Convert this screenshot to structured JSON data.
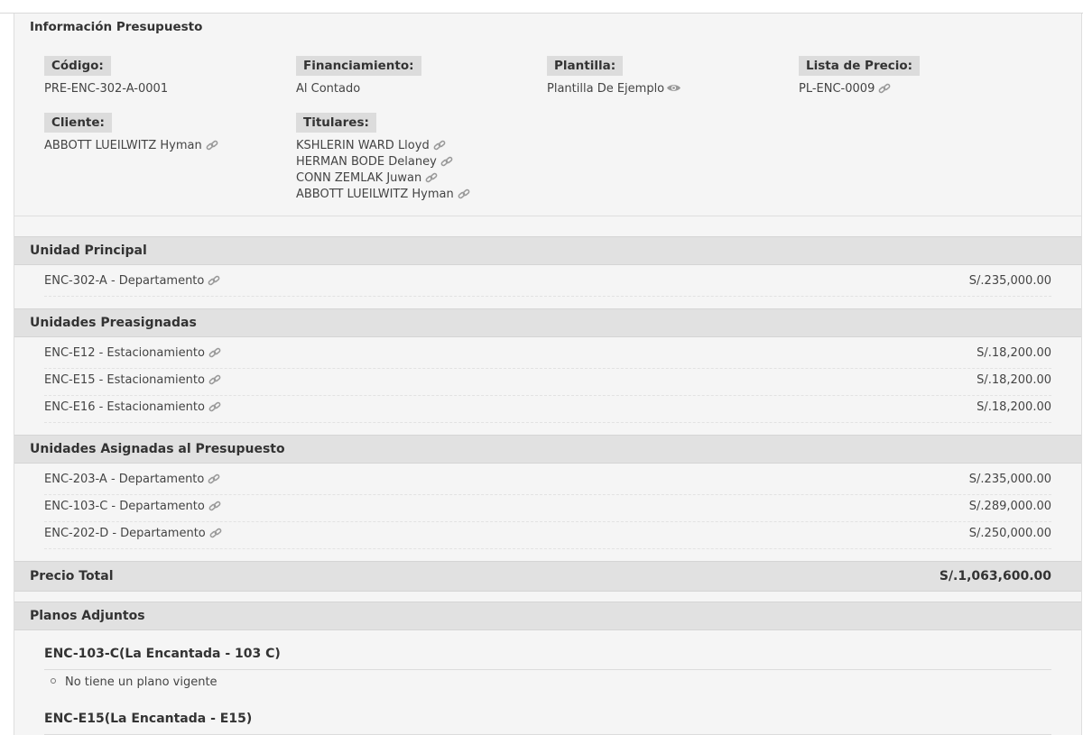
{
  "info": {
    "title": "Información Presupuesto",
    "fields": [
      {
        "label": "Código:",
        "values": [
          "PRE-ENC-302-A-0001"
        ],
        "icon": ""
      },
      {
        "label": "Financiamiento:",
        "values": [
          "Al Contado"
        ],
        "icon": ""
      },
      {
        "label": "Plantilla:",
        "values": [
          "Plantilla De Ejemplo"
        ],
        "icon": "eye-icon"
      },
      {
        "label": "Lista de Precio:",
        "values": [
          "PL-ENC-0009"
        ],
        "icon": "link-icon"
      },
      {
        "label": "Cliente:",
        "values": [
          "ABBOTT LUEILWITZ Hyman"
        ],
        "icon": "link-icon"
      },
      {
        "label": "Titulares:",
        "values": [
          "KSHLERIN WARD Lloyd",
          "HERMAN BODE Delaney",
          "CONN ZEMLAK Juwan",
          "ABBOTT LUEILWITZ Hyman"
        ],
        "icon": "link-icon"
      }
    ]
  },
  "unidad_principal": {
    "title": "Unidad Principal",
    "items": [
      {
        "name": "ENC-302-A - Departamento",
        "price": "S/.235,000.00"
      }
    ]
  },
  "preasignadas": {
    "title": "Unidades Preasignadas",
    "items": [
      {
        "name": "ENC-E12 - Estacionamiento",
        "price": "S/.18,200.00"
      },
      {
        "name": "ENC-E15 - Estacionamiento",
        "price": "S/.18,200.00"
      },
      {
        "name": "ENC-E16 - Estacionamiento",
        "price": "S/.18,200.00"
      }
    ]
  },
  "asignadas": {
    "title": "Unidades Asignadas al Presupuesto",
    "items": [
      {
        "name": "ENC-203-A - Departamento",
        "price": "S/.235,000.00"
      },
      {
        "name": "ENC-103-C - Departamento",
        "price": "S/.289,000.00"
      },
      {
        "name": "ENC-202-D - Departamento",
        "price": "S/.250,000.00"
      }
    ]
  },
  "total": {
    "label": "Precio Total",
    "value": "S/.1,063,600.00"
  },
  "planos": {
    "title": "Planos Adjuntos",
    "groups": [
      {
        "title": "ENC-103-C(La Encantada - 103 C)",
        "items": [
          "No tiene un plano vigente"
        ]
      },
      {
        "title": "ENC-E15(La Encantada - E15)",
        "items": []
      }
    ]
  },
  "colors": {
    "panel_bg": "#f5f5f5",
    "header_bg": "#e1e1e1",
    "label_bg": "#dcdcdc",
    "text": "#333333"
  }
}
